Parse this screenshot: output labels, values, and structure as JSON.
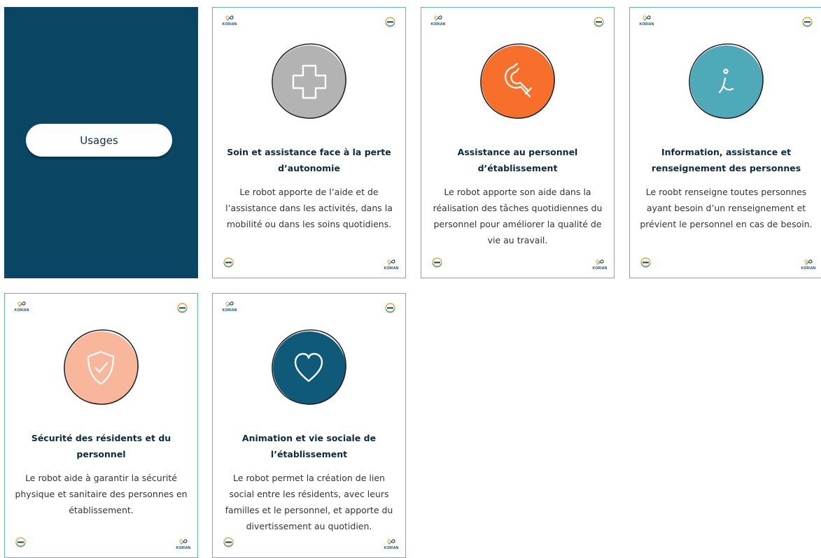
{
  "usages": {
    "label": "Usages"
  },
  "brand": {
    "korian_label": "KORIAN"
  },
  "colors": {
    "tile_bg": "#0b4564",
    "card_border": "#5fb6c2",
    "soin_circle": "#b3b3b3",
    "assistance_circle": "#f86f2c",
    "information_circle": "#4ea9b9",
    "securite_circle": "#f8b79a",
    "animation_circle": "#0f5a78"
  },
  "cards": [
    {
      "icon": "medical-cross-icon",
      "title": "Soin et assistance face à la perte d’autonomie",
      "description": "Le robot apporte de l’aide et de l’assistance dans les activités, dans la mobilité ou dans les soins quotidiens."
    },
    {
      "icon": "magnet-icon",
      "title": "Assistance au personnel d’établissement",
      "description": "Le robot apporte son aide dans la réalisation des tâches quotidiennes du personnel pour améliorer la qualité de vie au travail."
    },
    {
      "icon": "information-icon",
      "title": "Information, assistance et renseignement des personnes",
      "description": "Le roobt renseigne toutes personnes ayant besoin d’un renseignement et prévient le personnel en cas de besoin."
    },
    {
      "icon": "shield-check-icon",
      "title": "Sécurité des résidents et du personnel",
      "description": "Le robot aide à garantir la sécurité physique et sanitaire des personnes en établissement."
    },
    {
      "icon": "heart-icon",
      "title": "Animation et vie sociale de l’établissement",
      "description": "Le robot permet la création de lien social entre les résidents, avec leurs familles et le personnel, et apporte du divertissement au quotidien."
    }
  ]
}
